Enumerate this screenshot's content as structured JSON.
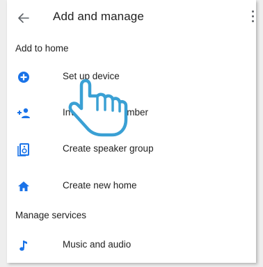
{
  "header": {
    "back_icon": "arrow-back-icon",
    "title": "Add and manage",
    "more_icon": "more-vert-icon"
  },
  "sections": [
    {
      "label": "Add to home",
      "items": [
        {
          "icon": "add-circle-icon",
          "label": "Set up device"
        },
        {
          "icon": "person-add-icon",
          "label": "Invite home member"
        },
        {
          "icon": "speaker-group-icon",
          "label": "Create speaker group"
        },
        {
          "icon": "home-icon",
          "label": "Create new home"
        }
      ]
    },
    {
      "label": "Manage services",
      "items": [
        {
          "icon": "music-note-icon",
          "label": "Music and audio"
        }
      ]
    }
  ],
  "overlay": {
    "icon": "pointing-hand-icon"
  },
  "colors": {
    "accent": "#1a73e8",
    "hand_stroke": "#3aa0d4",
    "text": "#212121"
  }
}
